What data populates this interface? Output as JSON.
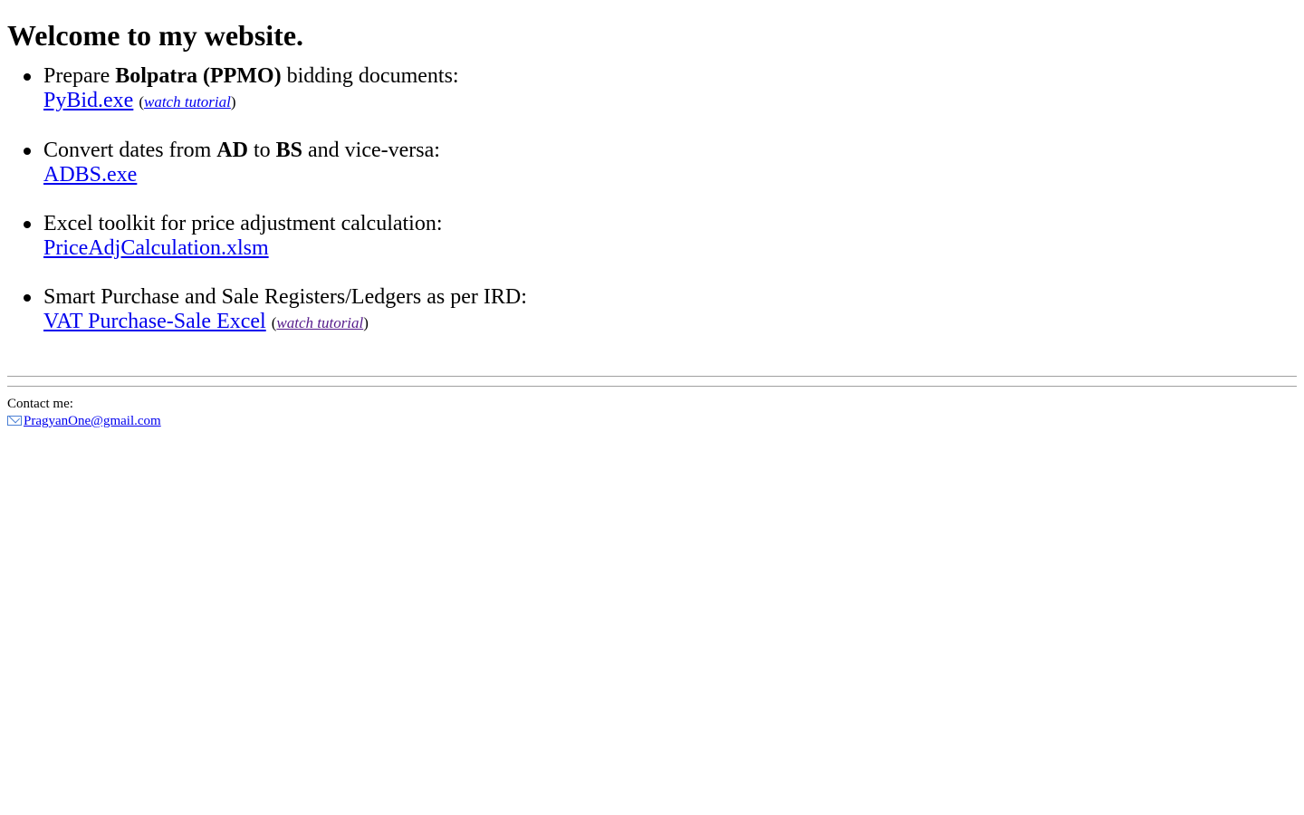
{
  "page": {
    "title": "Welcome to my website."
  },
  "items": [
    {
      "prefix": "Prepare ",
      "bold1": "Bolpatra (PPMO)",
      "suffix": " bidding documents:",
      "link_label": "PyBid.exe",
      "tutorial": {
        "open": "(",
        "label": "watch tutorial",
        "close": ")",
        "visited": false
      }
    },
    {
      "prefix": "Convert dates from ",
      "bold1": "AD",
      "middle": " to ",
      "bold2": "BS",
      "suffix": " and vice-versa:",
      "link_label": "ADBS.exe"
    },
    {
      "text": "Excel toolkit for price adjustment calculation:",
      "link_label": "PriceAdjCalculation.xlsm"
    },
    {
      "text": "Smart Purchase and Sale Registers/Ledgers as per IRD:",
      "link_label": "VAT Purchase-Sale Excel",
      "tutorial": {
        "open": "(",
        "label": "watch tutorial",
        "close": ")",
        "visited": true
      }
    }
  ],
  "contact": {
    "label": "Contact me:",
    "icon": "email-icon",
    "email": "PragyanOne@gmail.com"
  },
  "colors": {
    "link": "#0000ee",
    "visited_link": "#551a8b",
    "text": "#000000",
    "background": "#ffffff"
  }
}
